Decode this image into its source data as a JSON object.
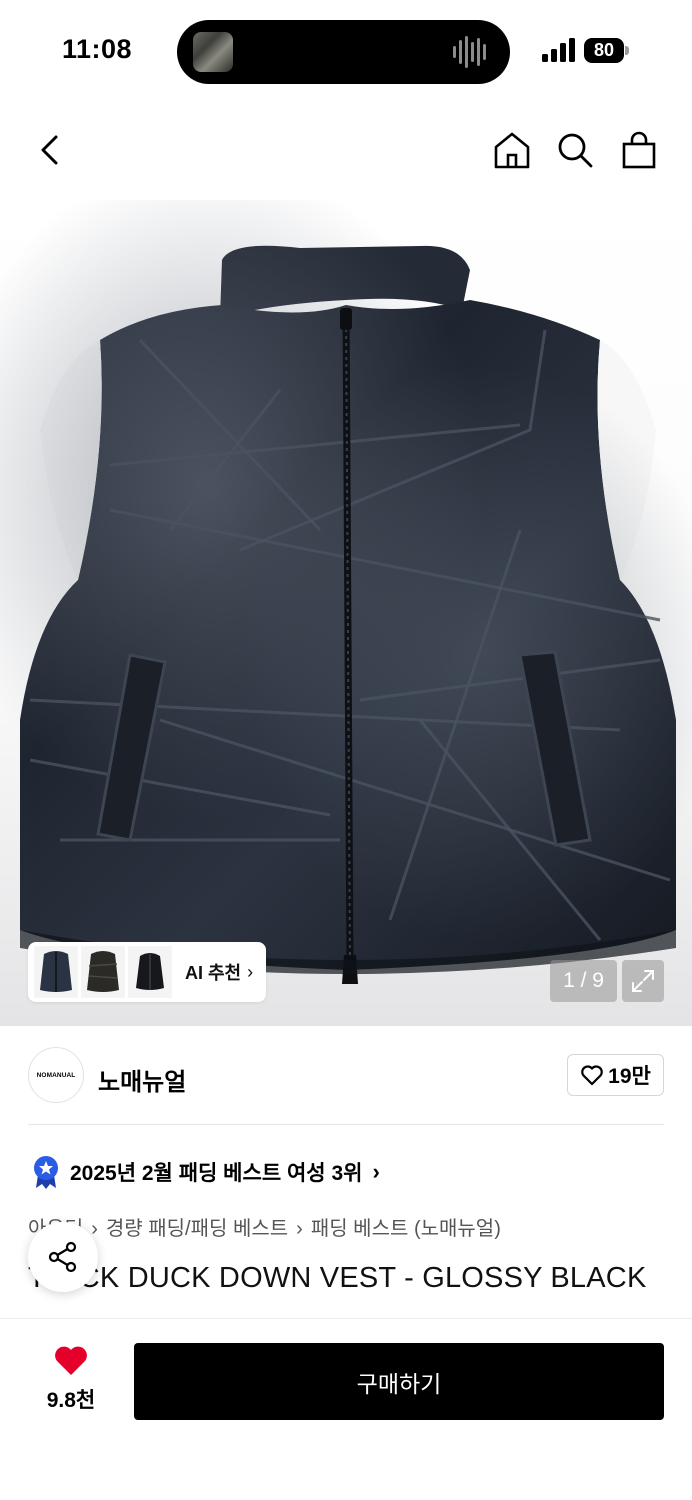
{
  "status_bar": {
    "time": "11:08",
    "battery": "80"
  },
  "nav": {
    "back_icon": "chevron-left-icon",
    "home_icon": "home-icon",
    "search_icon": "search-icon",
    "cart_icon": "shopping-bag-icon"
  },
  "gallery": {
    "page_indicator": "1 / 9",
    "ai_recommend_label": "AI 추천",
    "ai_recommend_chevron": "›"
  },
  "brand": {
    "logo_text": "NOMANUAL",
    "name": "노매뉴얼",
    "like_count": "19만"
  },
  "ranking": {
    "text": "2025년 2월 패딩 베스트 여성 3위",
    "chevron": "›"
  },
  "breadcrumb": {
    "items": [
      "아우터",
      "경량 패딩/패딩 베스트",
      "패딩 베스트 (노매뉴얼)"
    ],
    "separator": "›"
  },
  "product": {
    "title": "T.B.CK DUCK DOWN VEST - GLOSSY BLACK"
  },
  "bottom_bar": {
    "wish_count": "9.8천",
    "buy_label": "구매하기"
  },
  "colors": {
    "accent_heart": "#e4002b",
    "buy_button": "#000000",
    "ranking_badge": "#2b5ce6"
  }
}
